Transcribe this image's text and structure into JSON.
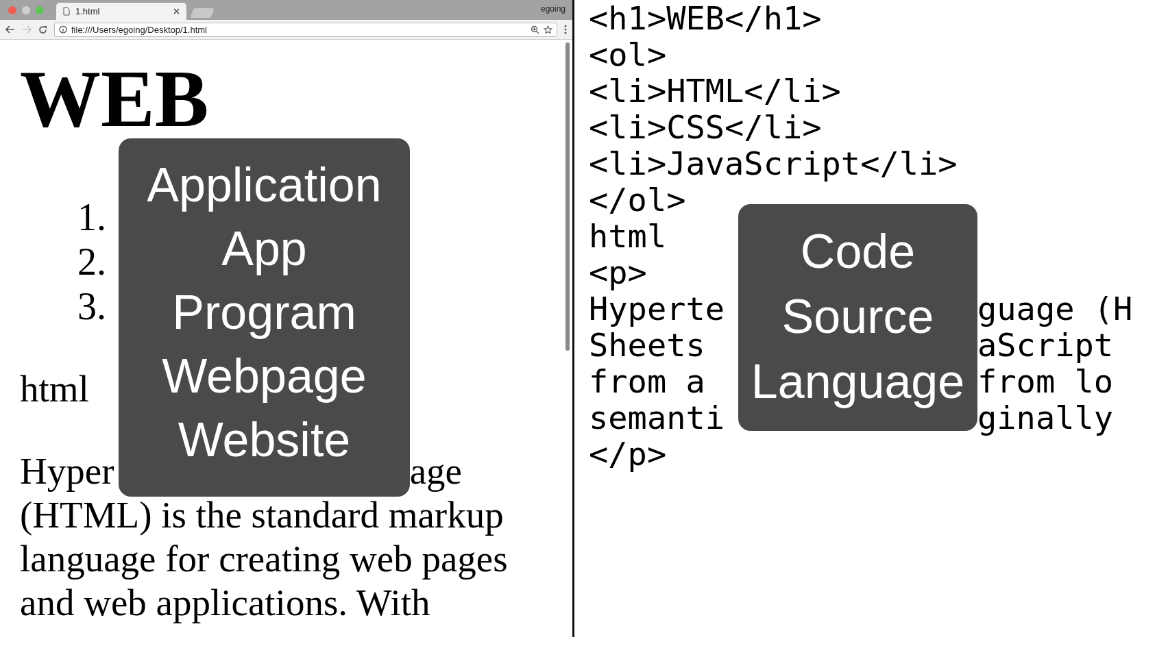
{
  "browser": {
    "tab_title": "1.html",
    "user": "egoing",
    "address": "file:///Users/egoing/Desktop/1.html",
    "forward_disabled": true
  },
  "page": {
    "heading": "WEB",
    "list": [
      {
        "number": "1."
      },
      {
        "number": "2."
      },
      {
        "number": "3."
      }
    ],
    "label": "html",
    "paragraph_first_line": {
      "before": "Hyper",
      "after": "age"
    },
    "paragraph": "(HTML) is the standard markup\nlanguage for creating web pages\nand web applications. With"
  },
  "overlay_left": {
    "words": [
      "Application",
      "App",
      "Program",
      "Webpage",
      "Website"
    ]
  },
  "code": {
    "lines": [
      {
        "kind": "full",
        "text": "<h1>WEB</h1>"
      },
      {
        "kind": "full",
        "text": "<ol>"
      },
      {
        "kind": "full",
        "text": "<li>HTML</li>"
      },
      {
        "kind": "full",
        "text": "<li>CSS</li>"
      },
      {
        "kind": "full",
        "text": "<li>JavaScript</li>"
      },
      {
        "kind": "full",
        "text": "</ol>"
      },
      {
        "kind": "full",
        "text": "html"
      },
      {
        "kind": "full",
        "text": "<p>"
      },
      {
        "kind": "split",
        "before": "Hyperte",
        "after": "guage (H"
      },
      {
        "kind": "split",
        "before": "Sheets",
        "after": "aScript"
      },
      {
        "kind": "split",
        "before": "from a",
        "after": "from lo"
      },
      {
        "kind": "split",
        "before": "semanti",
        "after": "ginally"
      },
      {
        "kind": "full",
        "text": "</p>"
      }
    ]
  },
  "overlay_right": {
    "words": [
      "Code",
      "Source",
      "Language"
    ]
  }
}
